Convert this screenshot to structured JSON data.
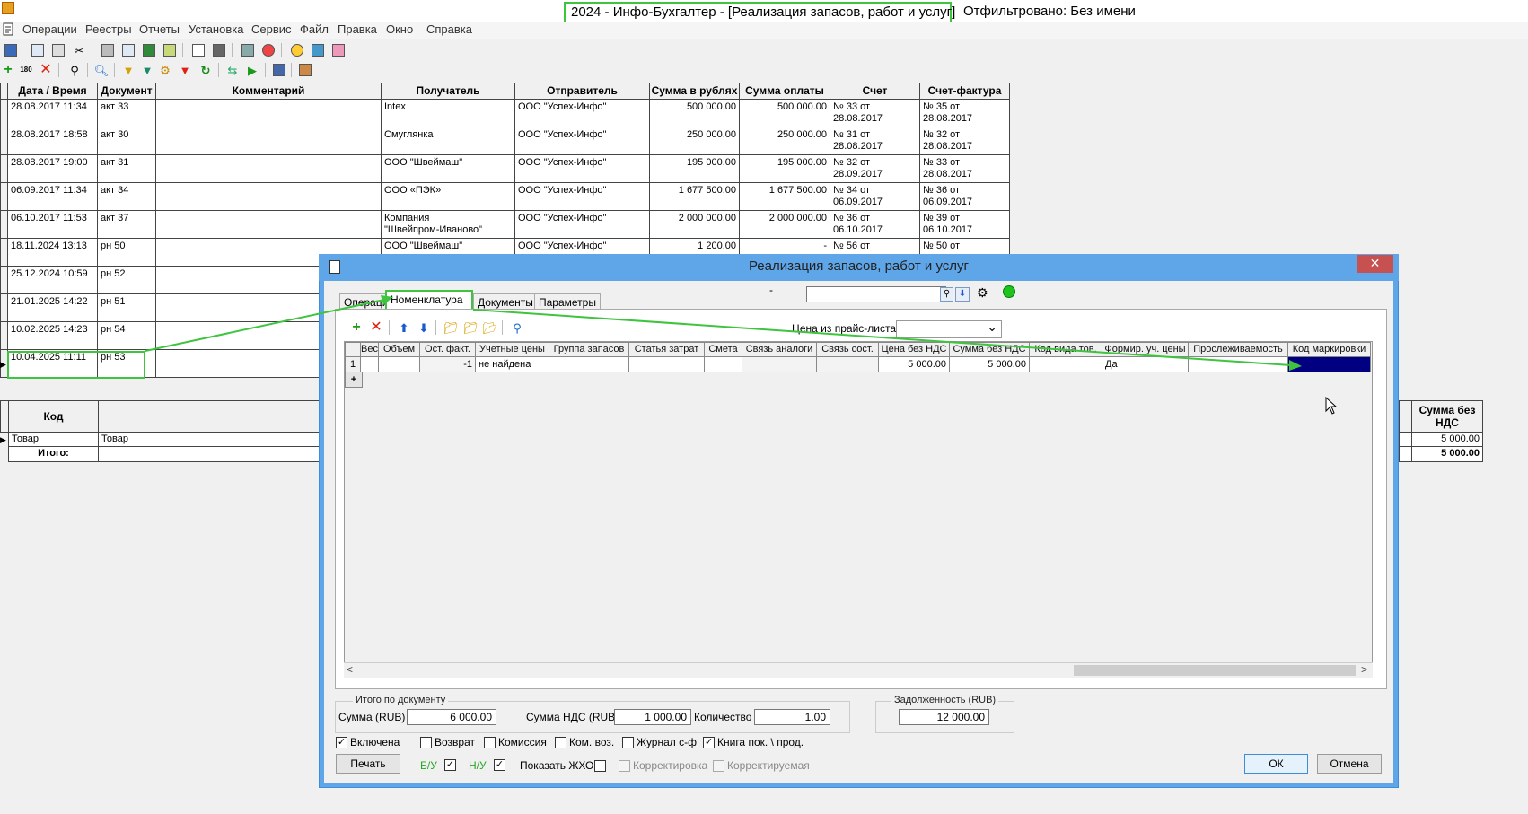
{
  "window": {
    "title": "2024 - Инфо-Бухгалтер - [Реализация запасов, работ и услуг]",
    "filter": "Отфильтровано: Без имени"
  },
  "menu": [
    "Операции",
    "Реестры",
    "Отчеты",
    "Установка",
    "Сервис",
    "Файл",
    "Правка",
    "Окно",
    "Справка"
  ],
  "main_grid": {
    "columns": [
      "Дата / Время",
      "Документ",
      "Комментарий",
      "Получатель",
      "Отправитель",
      "Сумма в рублях",
      "Сумма оплаты",
      "Счет",
      "Счет-фактура"
    ],
    "rows": [
      [
        "28.08.2017 11:34",
        "акт 33",
        "",
        "Intex",
        "ООО \"Успех-Инфо\"",
        "500 000.00",
        "500 000.00",
        "№ 33 от\n28.08.2017",
        "№ 35 от\n28.08.2017"
      ],
      [
        "28.08.2017 18:58",
        "акт 30",
        "",
        "Смуглянка",
        "ООО \"Успех-Инфо\"",
        "250 000.00",
        "250 000.00",
        "№ 31 от\n28.08.2017",
        "№ 32 от\n28.08.2017"
      ],
      [
        "28.08.2017 19:00",
        "акт 31",
        "",
        "ООО \"Швеймаш\"",
        "ООО \"Успех-Инфо\"",
        "195 000.00",
        "195 000.00",
        "№ 32 от\n28.09.2017",
        "№ 33 от\n28.08.2017"
      ],
      [
        "06.09.2017 11:34",
        "акт 34",
        "",
        "ООО «ПЭК»",
        "ООО \"Успех-Инфо\"",
        "1 677 500.00",
        "1 677 500.00",
        "№ 34 от\n06.09.2017",
        "№ 36 от\n06.09.2017"
      ],
      [
        "06.10.2017 11:53",
        "акт 37",
        "",
        "Компания\n\"Швейпром-Иваново\"",
        "ООО \"Успех-Инфо\"",
        "2 000 000.00",
        "2 000 000.00",
        "№ 36 от\n06.10.2017",
        "№ 39 от\n06.10.2017"
      ],
      [
        "18.11.2024 13:13",
        "рн 50",
        "",
        "ООО \"Швеймаш\"",
        "ООО \"Успех-Инфо\"",
        "1 200.00",
        "-",
        "№ 56 от",
        "№ 50 от"
      ],
      [
        "25.12.2024 10:59",
        "рн 52",
        "",
        "",
        "",
        "",
        "",
        "",
        ""
      ],
      [
        "21.01.2025 14:22",
        "рн 51",
        "",
        "",
        "",
        "",
        "",
        "",
        ""
      ],
      [
        "10.02.2025 14:23",
        "рн 54",
        "",
        "",
        "",
        "",
        "",
        "",
        ""
      ],
      [
        "10.04.2025 11:11",
        "рн 53",
        "",
        "",
        "",
        "",
        "",
        "",
        ""
      ]
    ]
  },
  "lower_grid": {
    "col_code": "Код",
    "col_sum": "Сумма без НДС",
    "row_code": "Товар",
    "row_name": "Товар",
    "row_sum": "5 000.00",
    "total_label": "Итого:",
    "total_sum": "5 000.00"
  },
  "dialog": {
    "title": "Реализация запасов, работ и услуг",
    "close": "✕",
    "dash": "-",
    "tabs": [
      "Операция",
      "Номенклатура",
      "Документы",
      "Параметры"
    ],
    "price_label": "Цена из прайс-листа:",
    "grid_columns": [
      "Вес",
      "Объем",
      "Ост. факт.",
      "Учетные цены",
      "Группа запасов",
      "Статья затрат",
      "Смета",
      "Связь аналоги",
      "Связь сост.",
      "Цена без НДС",
      "Сумма без НДС",
      "Код вида тов.",
      "Формир. уч. цены",
      "Прослеживаемость",
      "Код маркировки"
    ],
    "grid_row": {
      "num": "1",
      "ost": "-1",
      "prices": "не найдена",
      "price": "5 000.00",
      "sum": "5 000.00",
      "formir": "Да"
    },
    "add_row": "+",
    "totals": {
      "legend": "Итого по документу",
      "sum_label": "Сумма (RUB)",
      "sum": "6 000.00",
      "vat_label": "Сумма НДС (RUB",
      "vat": "1 000.00",
      "qty_label": "Количество",
      "qty": "1.00"
    },
    "debt": {
      "legend": "Задолженность (RUB)",
      "value": "12 000.00"
    },
    "checks": {
      "included": "Включена",
      "return": "Возврат",
      "commission": "Комиссия",
      "kom_voz": "Ком. воз.",
      "journal": "Журнал с-ф",
      "book": "Книга пок. \\ прод.",
      "bu": "Б/У",
      "nu": "Н/У",
      "show": "Показать ЖХО",
      "corr": "Корректировка",
      "corrected": "Корректируемая"
    },
    "buttons": {
      "print": "Печать",
      "ok": "ОК",
      "cancel": "Отмена"
    },
    "check_mark": "✓"
  },
  "colors": {
    "highlight_green": "#3ec43e",
    "dialog_border": "#5fa6e8",
    "selected_cell": "#000080"
  }
}
